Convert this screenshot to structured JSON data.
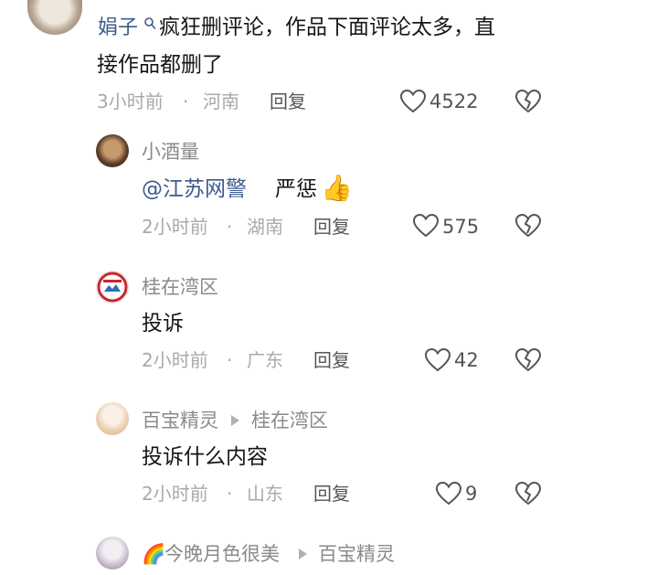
{
  "main_comment": {
    "username": "娟子",
    "text_line1": "疯狂删评论，作品下面评论太多，直",
    "text_line2": "接作品都删了",
    "time": "3小时前",
    "location": "河南",
    "reply_label": "回复",
    "likes": "4522"
  },
  "replies": [
    {
      "username": "小酒量",
      "mention": "@江苏网警",
      "text": "严惩",
      "emoji": "👍",
      "time": "2小时前",
      "location": "湖南",
      "reply_label": "回复",
      "likes": "575"
    },
    {
      "username": "桂在湾区",
      "text": "投诉",
      "time": "2小时前",
      "location": "广东",
      "reply_label": "回复",
      "likes": "42"
    },
    {
      "username": "百宝精灵",
      "reply_to": "桂在湾区",
      "text": "投诉什么内容",
      "time": "2小时前",
      "location": "山东",
      "reply_label": "回复",
      "likes": "9"
    },
    {
      "username_emoji": "🌈",
      "username": "今晚月色很美",
      "reply_to": "百宝精灵"
    }
  ],
  "icons": [
    "heart-outline-icon",
    "dislike-broken-heart-icon",
    "search-icon",
    "reply-arrow-icon"
  ],
  "separator": "·"
}
